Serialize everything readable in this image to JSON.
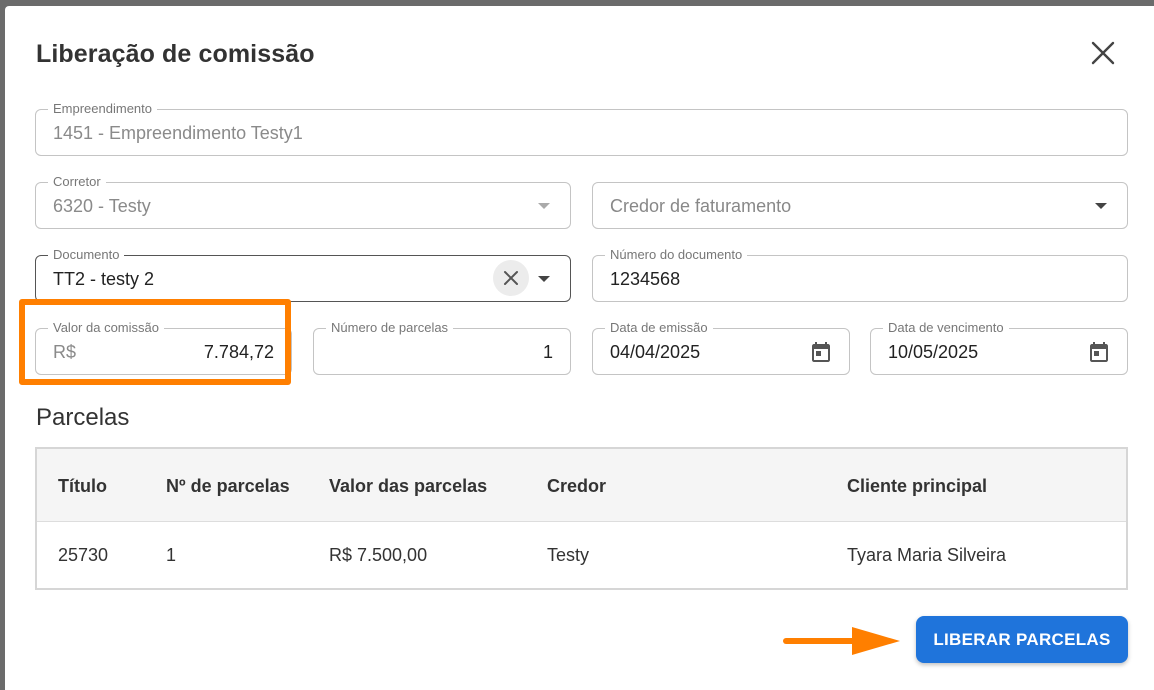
{
  "dialog": {
    "title": "Liberação de comissão"
  },
  "form": {
    "empreendimento": {
      "label": "Empreendimento",
      "value": "1451 - Empreendimento Testy1"
    },
    "corretor": {
      "label": "Corretor",
      "value": "6320 - Testy"
    },
    "credor": {
      "placeholder": "Credor de faturamento"
    },
    "documento": {
      "label": "Documento",
      "value": "TT2 - testy 2"
    },
    "numero_documento": {
      "label": "Número do documento",
      "value": "1234568"
    },
    "valor_comissao": {
      "label": "Valor da comissão",
      "prefix": "R$",
      "value": "7.784,72"
    },
    "numero_parcelas": {
      "label": "Número de parcelas",
      "value": "1"
    },
    "data_emissao": {
      "label": "Data de emissão",
      "value": "04/04/2025"
    },
    "data_vencimento": {
      "label": "Data de vencimento",
      "value": "10/05/2025"
    }
  },
  "parcelas": {
    "title": "Parcelas",
    "columns": [
      "Título",
      "Nº de parcelas",
      "Valor das parcelas",
      "Credor",
      "Cliente principal"
    ],
    "rows": [
      [
        "25730",
        "1",
        "R$ 7.500,00",
        "Testy",
        "Tyara Maria Silveira"
      ]
    ]
  },
  "actions": {
    "liberar_label": "LIBERAR PARCELAS"
  },
  "colors": {
    "primary": "#1f74db",
    "annotation": "#ff7f00"
  },
  "icons": {
    "close": "close-icon",
    "clear": "clear-icon",
    "dropdown": "chevron-down-icon",
    "calendar": "calendar-icon"
  }
}
